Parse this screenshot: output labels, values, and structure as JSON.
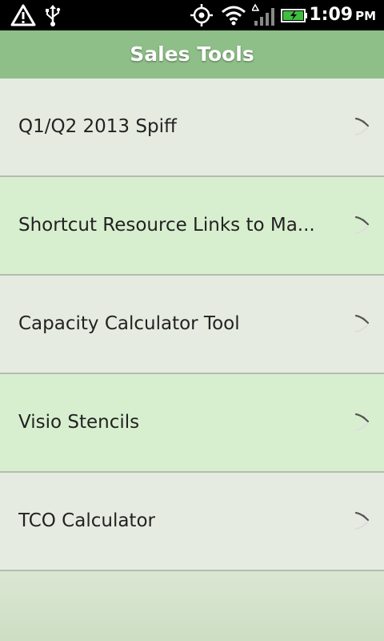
{
  "status_bar": {
    "time": "1:09",
    "ampm": "PM",
    "icons": [
      "warning-icon",
      "usb-icon",
      "gps-icon",
      "wifi-icon",
      "signal-icon",
      "battery-charging-icon"
    ]
  },
  "header": {
    "title": "Sales Tools"
  },
  "list": {
    "items": [
      {
        "label": "Q1/Q2 2013 Spiff",
        "icon": "chevron-right-icon"
      },
      {
        "label": "Shortcut Resource Links to Ma...",
        "icon": "chevron-right-icon"
      },
      {
        "label": "Capacity Calculator Tool",
        "icon": "chevron-right-icon"
      },
      {
        "label": "Visio Stencils",
        "icon": "chevron-right-icon"
      },
      {
        "label": "TCO Calculator",
        "icon": "chevron-right-icon"
      }
    ]
  },
  "colors": {
    "title_bar": "#8fbf88",
    "row_light": "#e6ebe1",
    "row_green": "#d8efcf",
    "status_bar": "#000000"
  }
}
